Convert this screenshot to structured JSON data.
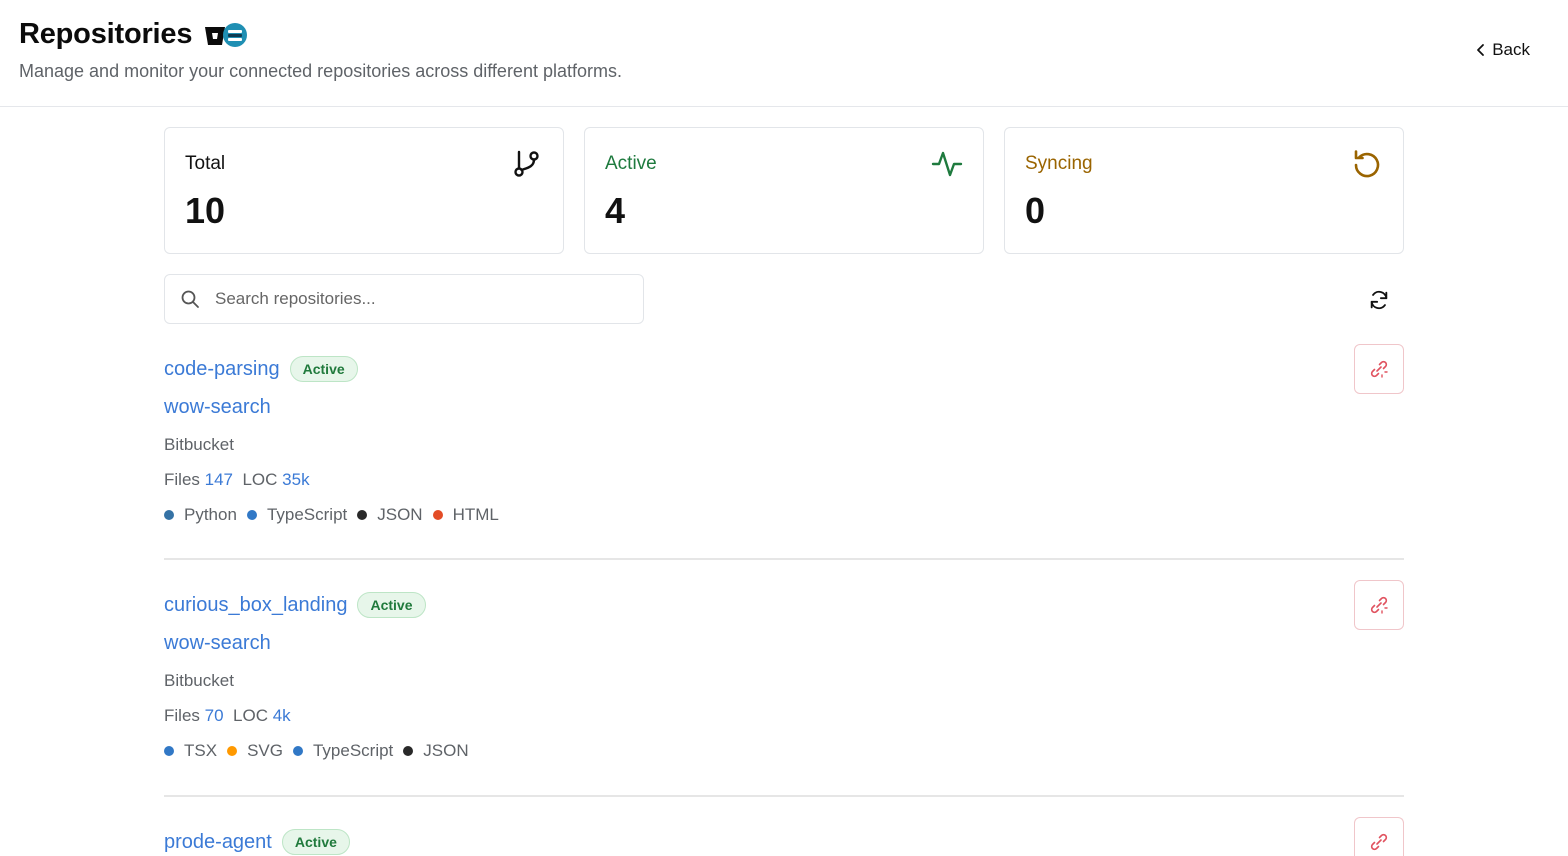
{
  "header": {
    "title": "Repositories",
    "subtitle": "Manage and monitor your connected repositories across different platforms.",
    "back_label": "Back"
  },
  "stats": [
    {
      "label": "Total",
      "value": "10",
      "color": "#111111",
      "icon": "git-branch-icon"
    },
    {
      "label": "Active",
      "value": "4",
      "color": "#1e7a3e",
      "icon": "activity-icon"
    },
    {
      "label": "Syncing",
      "value": "0",
      "color": "#9a6400",
      "icon": "refresh-ccw-icon"
    }
  ],
  "search": {
    "placeholder": "Search repositories...",
    "value": ""
  },
  "repositories": [
    {
      "name": "code-parsing",
      "status": "Active",
      "workspace": "wow-search",
      "platform": "Bitbucket",
      "files_label": "Files",
      "files": "147",
      "loc_label": "LOC",
      "loc": "35k",
      "languages": [
        {
          "name": "Python",
          "color": "#3572A5"
        },
        {
          "name": "TypeScript",
          "color": "#3178C6"
        },
        {
          "name": "JSON",
          "color": "#292929"
        },
        {
          "name": "HTML",
          "color": "#E34C26"
        }
      ]
    },
    {
      "name": "curious_box_landing",
      "status": "Active",
      "workspace": "wow-search",
      "platform": "Bitbucket",
      "files_label": "Files",
      "files": "70",
      "loc_label": "LOC",
      "loc": "4k",
      "languages": [
        {
          "name": "TSX",
          "color": "#3178C6"
        },
        {
          "name": "SVG",
          "color": "#FF9900"
        },
        {
          "name": "TypeScript",
          "color": "#3178C6"
        },
        {
          "name": "JSON",
          "color": "#292929"
        }
      ]
    },
    {
      "name": "prode-agent",
      "status": "Active"
    }
  ],
  "colors": {
    "link": "#3b7ad6",
    "active_badge_bg": "#e7f6ea",
    "active_badge_text": "#207a3c",
    "unlink_icon": "#e0525f"
  }
}
